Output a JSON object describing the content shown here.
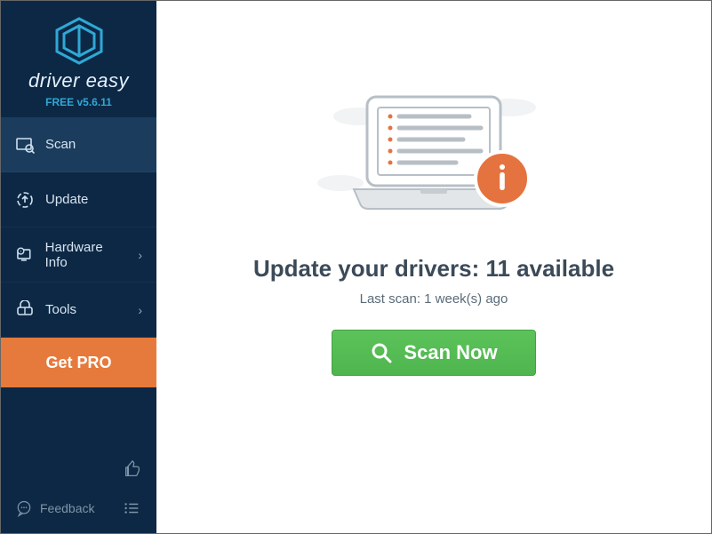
{
  "app": {
    "name": "driver easy",
    "version_label": "FREE v5.6.11"
  },
  "sidebar": {
    "items": [
      {
        "label": "Scan",
        "icon": "scan-icon",
        "active": true,
        "has_submenu": false
      },
      {
        "label": "Update",
        "icon": "update-icon",
        "active": false,
        "has_submenu": false
      },
      {
        "label": "Hardware Info",
        "icon": "hardware-info-icon",
        "active": false,
        "has_submenu": true
      },
      {
        "label": "Tools",
        "icon": "tools-icon",
        "active": false,
        "has_submenu": true
      }
    ],
    "get_pro_label": "Get PRO",
    "feedback_label": "Feedback"
  },
  "main": {
    "headline": "Update your drivers: 11 available",
    "last_scan": "Last scan: 1 week(s) ago",
    "scan_button_label": "Scan Now"
  },
  "colors": {
    "sidebar_bg": "#0c2845",
    "sidebar_active": "#1b3c5c",
    "accent_orange": "#e67a3c",
    "scan_green": "#4fb54e",
    "info_badge": "#e5733f",
    "brand_cyan": "#2fa8d6"
  }
}
